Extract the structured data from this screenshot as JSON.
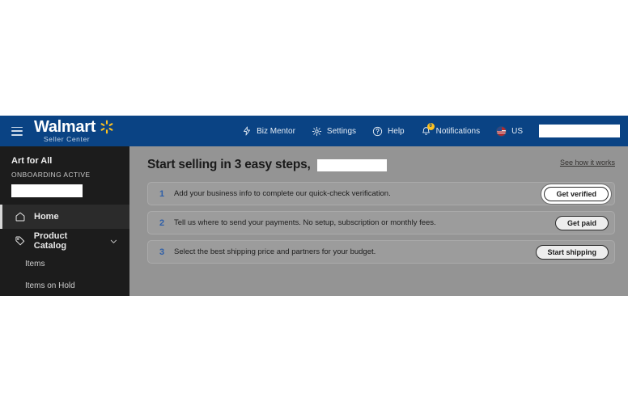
{
  "header": {
    "menu_icon": "hamburger-icon",
    "brand_name": "Walmart",
    "brand_subtitle": "Seller Center",
    "nav": [
      {
        "label": "Biz Mentor",
        "icon": "lightning-icon"
      },
      {
        "label": "Settings",
        "icon": "gear-icon"
      },
      {
        "label": "Help",
        "icon": "question-circle-icon"
      },
      {
        "label": "Notifications",
        "icon": "bell-icon",
        "badge": "0"
      }
    ],
    "locale": {
      "label": "US",
      "icon": "us-flag-icon"
    },
    "account_redacted": ""
  },
  "sidebar": {
    "store_name": "Art for All",
    "store_status": "ONBOARDING ACTIVE",
    "redacted": "",
    "items": [
      {
        "label": "Home",
        "icon": "home-icon",
        "active": true
      },
      {
        "label": "Product Catalog",
        "icon": "tag-icon",
        "expanded": true
      }
    ],
    "sub_items": [
      {
        "label": "Items"
      },
      {
        "label": "Items on Hold"
      }
    ]
  },
  "main": {
    "title": "Start selling in 3 easy steps,",
    "title_redacted": "",
    "how_it_works_link": "See how it works",
    "steps": [
      {
        "number": "1",
        "text": "Add your business info to complete our quick-check verification.",
        "button": "Get verified",
        "focused": true
      },
      {
        "number": "2",
        "text": "Tell us where to send your payments. No setup, subscription or monthly fees.",
        "button": "Get paid",
        "focused": false
      },
      {
        "number": "3",
        "text": "Select the best shipping price and partners for your budget.",
        "button": "Start shipping",
        "focused": false
      }
    ]
  },
  "colors": {
    "header_blue": "#0a4384",
    "spark_yellow": "#ffc220",
    "sidebar_dark": "#1c1c1c",
    "content_gray": "#949494",
    "step_number_blue": "#2f5fa8"
  }
}
